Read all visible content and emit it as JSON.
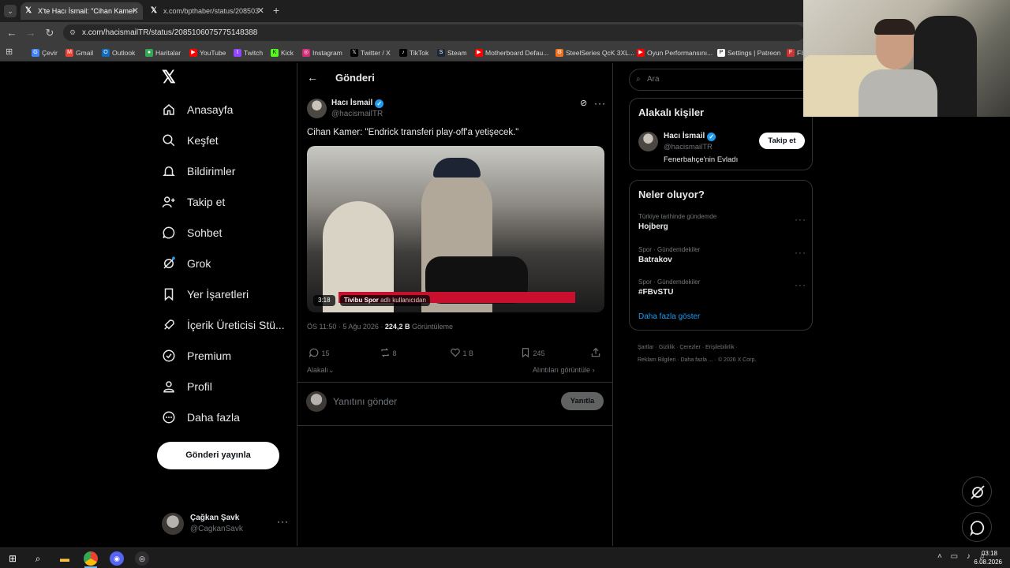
{
  "browser": {
    "tabs": [
      {
        "title": "X'te Hacı İsmail: \"Cihan Kamer:",
        "active": true
      },
      {
        "title": "x.com/bpthaber/status/208503",
        "active": false
      }
    ],
    "url": "x.com/hacismailTR/status/2085106075775148388",
    "bookmarks": [
      "Çevir",
      "Gmail",
      "Outlook",
      "Haritalar",
      "YouTube",
      "Twitch",
      "Kick",
      "Instagram",
      "Twitter / X",
      "TikTok",
      "Steam",
      "Motherboard Defau...",
      "SteelSeries QcK 3XL...",
      "Oyun Performansını...",
      "Settings | Patreon",
      "FIF"
    ]
  },
  "nav": {
    "items": [
      "Anasayfa",
      "Keşfet",
      "Bildirimler",
      "Takip et",
      "Sohbet",
      "Grok",
      "Yer İşaretleri",
      "İçerik Üreticisi Stü...",
      "Premium",
      "Profil",
      "Daha fazla"
    ],
    "post_button": "Gönderi yayınla",
    "account": {
      "name": "Çağkan Şavk",
      "handle": "@CagkanSavk"
    }
  },
  "post": {
    "header_title": "Gönderi",
    "author_name": "Hacı İsmail",
    "author_handle": "@hacismailTR",
    "text": "Cihan Kamer: \"Endrick transferi play-off'a yetişecek.\"",
    "video": {
      "duration": "3:18",
      "source_label": "Tivibu Spor",
      "source_suffix": "adlı kullanıcıdan",
      "progress": 0.0
    },
    "time": "ÖS 11:50 · 5 Ağu 2026 ·",
    "views_value": "224,2 B",
    "views_label": "Görüntüleme",
    "stats": {
      "replies": "15",
      "reposts": "8",
      "likes": "1 B",
      "bookmarks": "245"
    },
    "relevant_label": "Alakalı",
    "quotes_label": "Alıntıları görüntüle",
    "reply_placeholder": "Yanıtını gönder",
    "reply_button": "Yanıtla"
  },
  "right": {
    "search_placeholder": "Ara",
    "people": {
      "title": "Alakalı kişiler",
      "name": "Hacı İsmail",
      "handle": "@hacismailTR",
      "bio": "Fenerbahçe'nin Evladı",
      "follow": "Takip et"
    },
    "trends": {
      "title": "Neler oluyor?",
      "items": [
        {
          "context": "Türkiye tarihinde gündemde",
          "name": "Hojberg"
        },
        {
          "context": "Spor · Gündemdekiler",
          "name": "Batrakov"
        },
        {
          "context": "Spor · Gündemdekiler",
          "name": "#FBvSTU"
        }
      ],
      "more": "Daha fazla göster"
    },
    "footer": [
      "Şartlar",
      "Gizlilik",
      "Çerezler",
      "Erişilebilirlik",
      "Reklam Bilgileri",
      "Daha fazla ...",
      "© 2026 X Corp."
    ]
  },
  "taskbar": {
    "time": "03:18",
    "date": "6.08.2026"
  }
}
